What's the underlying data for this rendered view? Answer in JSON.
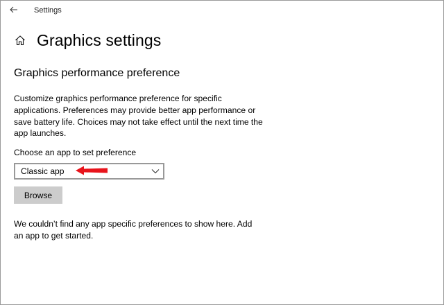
{
  "titlebar": {
    "back_icon": "arrow-left-icon",
    "app_title": "Settings"
  },
  "header": {
    "home_icon": "home-icon",
    "page_title": "Graphics settings"
  },
  "section": {
    "title": "Graphics performance preference",
    "description": "Customize graphics performance preference for specific applications. Preferences may provide better app performance or save battery life. Choices may not take effect until the next time the app launches."
  },
  "app_picker": {
    "label": "Choose an app to set preference",
    "selected_value": "Classic app",
    "chevron_icon": "chevron-down-icon",
    "annotation_arrow_color": "#e8141c",
    "browse_label": "Browse"
  },
  "empty_state": {
    "message": "We couldn’t find any app specific preferences to show here. Add an app to get started."
  },
  "colors": {
    "background": "#ffffff",
    "button_background": "#cccccc",
    "select_border": "#999999",
    "window_border": "#9a9a9a"
  }
}
